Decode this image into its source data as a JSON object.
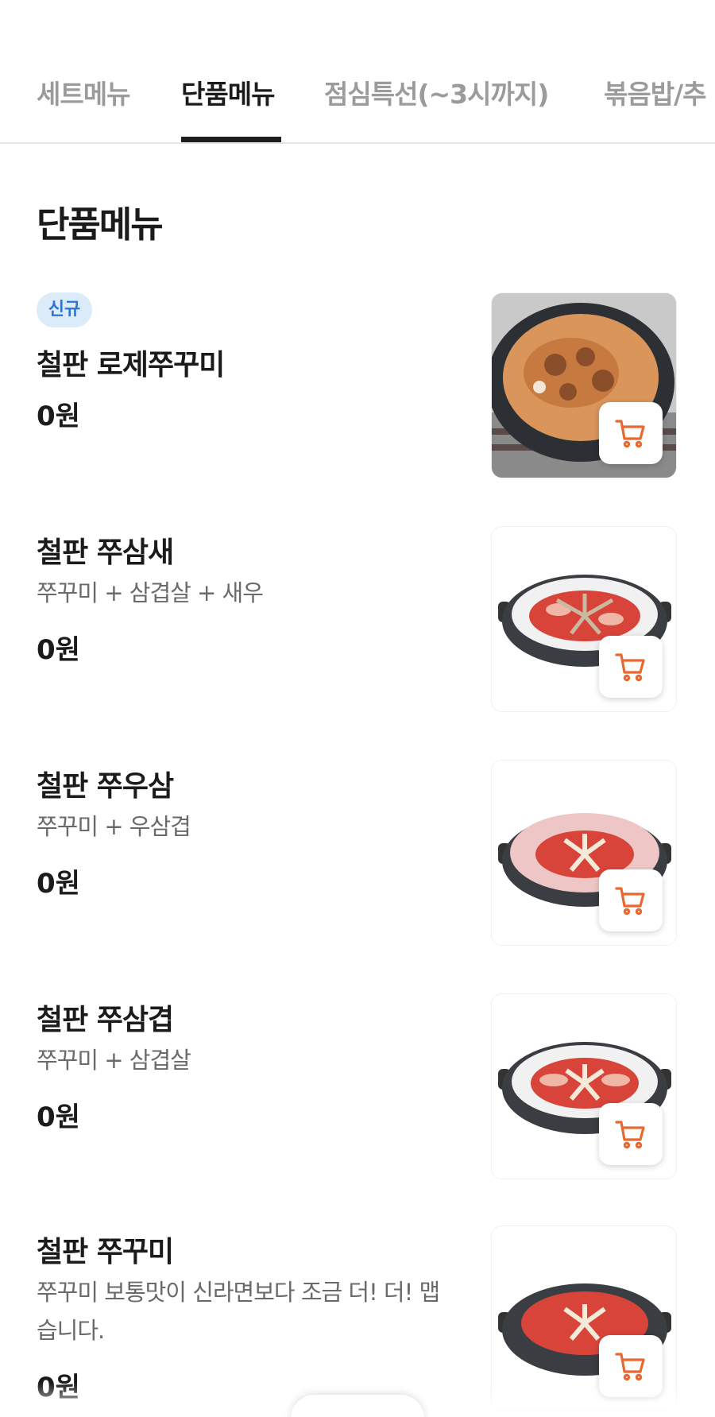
{
  "tabs": [
    {
      "label": "세트메뉴",
      "active": false
    },
    {
      "label": "단품메뉴",
      "active": true
    },
    {
      "label": "점심특선(~3시까지)",
      "active": false
    },
    {
      "label": "볶음밥/추",
      "active": false
    }
  ],
  "section": {
    "title": "단품메뉴"
  },
  "items": [
    {
      "badge": "신규",
      "name": "철판 로제쭈꾸미",
      "description": "",
      "price": "0원",
      "image": "rose-jjukkumi-photo"
    },
    {
      "badge": "",
      "name": "철판 쭈삼새",
      "description": "쭈꾸미 + 삼겹살 + 새우",
      "price": "0원",
      "image": "jjusamsae-photo"
    },
    {
      "badge": "",
      "name": "철판 쭈우삼",
      "description": "쭈꾸미 + 우삼겹",
      "price": "0원",
      "image": "jjuusam-photo"
    },
    {
      "badge": "",
      "name": "철판 쭈삼겹",
      "description": "쭈꾸미 + 삼겹살",
      "price": "0원",
      "image": "jjusamgyeop-photo"
    },
    {
      "badge": "",
      "name": "철판 쭈꾸미",
      "description": "쭈꾸미 보통맛이 신라면보다 조금 더! 더! 맵습니다.",
      "price": "0원",
      "image": "jjukkumi-photo"
    }
  ],
  "icons": {
    "cart": "cart-icon"
  },
  "colors": {
    "accent": "#e8682f",
    "badge_bg": "#dcebfa",
    "badge_text": "#2b74d6"
  }
}
